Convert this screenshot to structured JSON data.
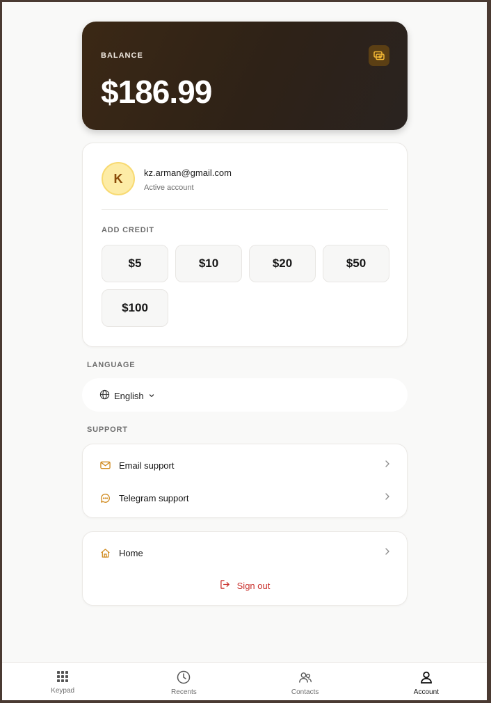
{
  "balance": {
    "label": "BALANCE",
    "amount": "$186.99",
    "icon": "money-icon",
    "accent": "#f2b735"
  },
  "account": {
    "avatar_initial": "K",
    "email": "kz.arman@gmail.com",
    "status": "Active account"
  },
  "add_credit": {
    "label": "ADD CREDIT",
    "amounts": [
      "$5",
      "$10",
      "$20",
      "$50",
      "$100"
    ]
  },
  "language": {
    "section_label": "LANGUAGE",
    "selected": "English",
    "icon": "globe-icon"
  },
  "support": {
    "section_label": "SUPPORT",
    "items": [
      {
        "label": "Email support",
        "icon": "mail-icon"
      },
      {
        "label": "Telegram support",
        "icon": "chat-icon"
      }
    ]
  },
  "nav_card": {
    "home_label": "Home",
    "signout_label": "Sign out"
  },
  "tabs": [
    {
      "label": "Keypad",
      "icon": "keypad-icon"
    },
    {
      "label": "Recents",
      "icon": "clock-icon"
    },
    {
      "label": "Contacts",
      "icon": "contacts-icon"
    },
    {
      "label": "Account",
      "icon": "user-icon",
      "active": true
    }
  ],
  "colors": {
    "accent": "#d08a1e",
    "danger": "#c9302c"
  }
}
